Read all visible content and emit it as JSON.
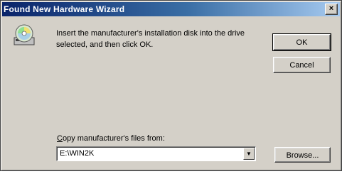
{
  "window": {
    "title": "Found New Hardware Wizard",
    "close_glyph": "×"
  },
  "message": "Insert the manufacturer's installation disk into the drive selected, and then click OK.",
  "icon": "disk-cd-icon",
  "buttons": {
    "ok_label": "OK",
    "cancel_label": "Cancel",
    "browse_label": "Browse..."
  },
  "copy_from": {
    "label_accel": "C",
    "label_rest": "opy manufacturer's files from:",
    "value": "E:\\WIN2K"
  },
  "colors": {
    "title_start": "#0a246a",
    "title_end": "#a6caf0",
    "face": "#d4d0c8"
  }
}
